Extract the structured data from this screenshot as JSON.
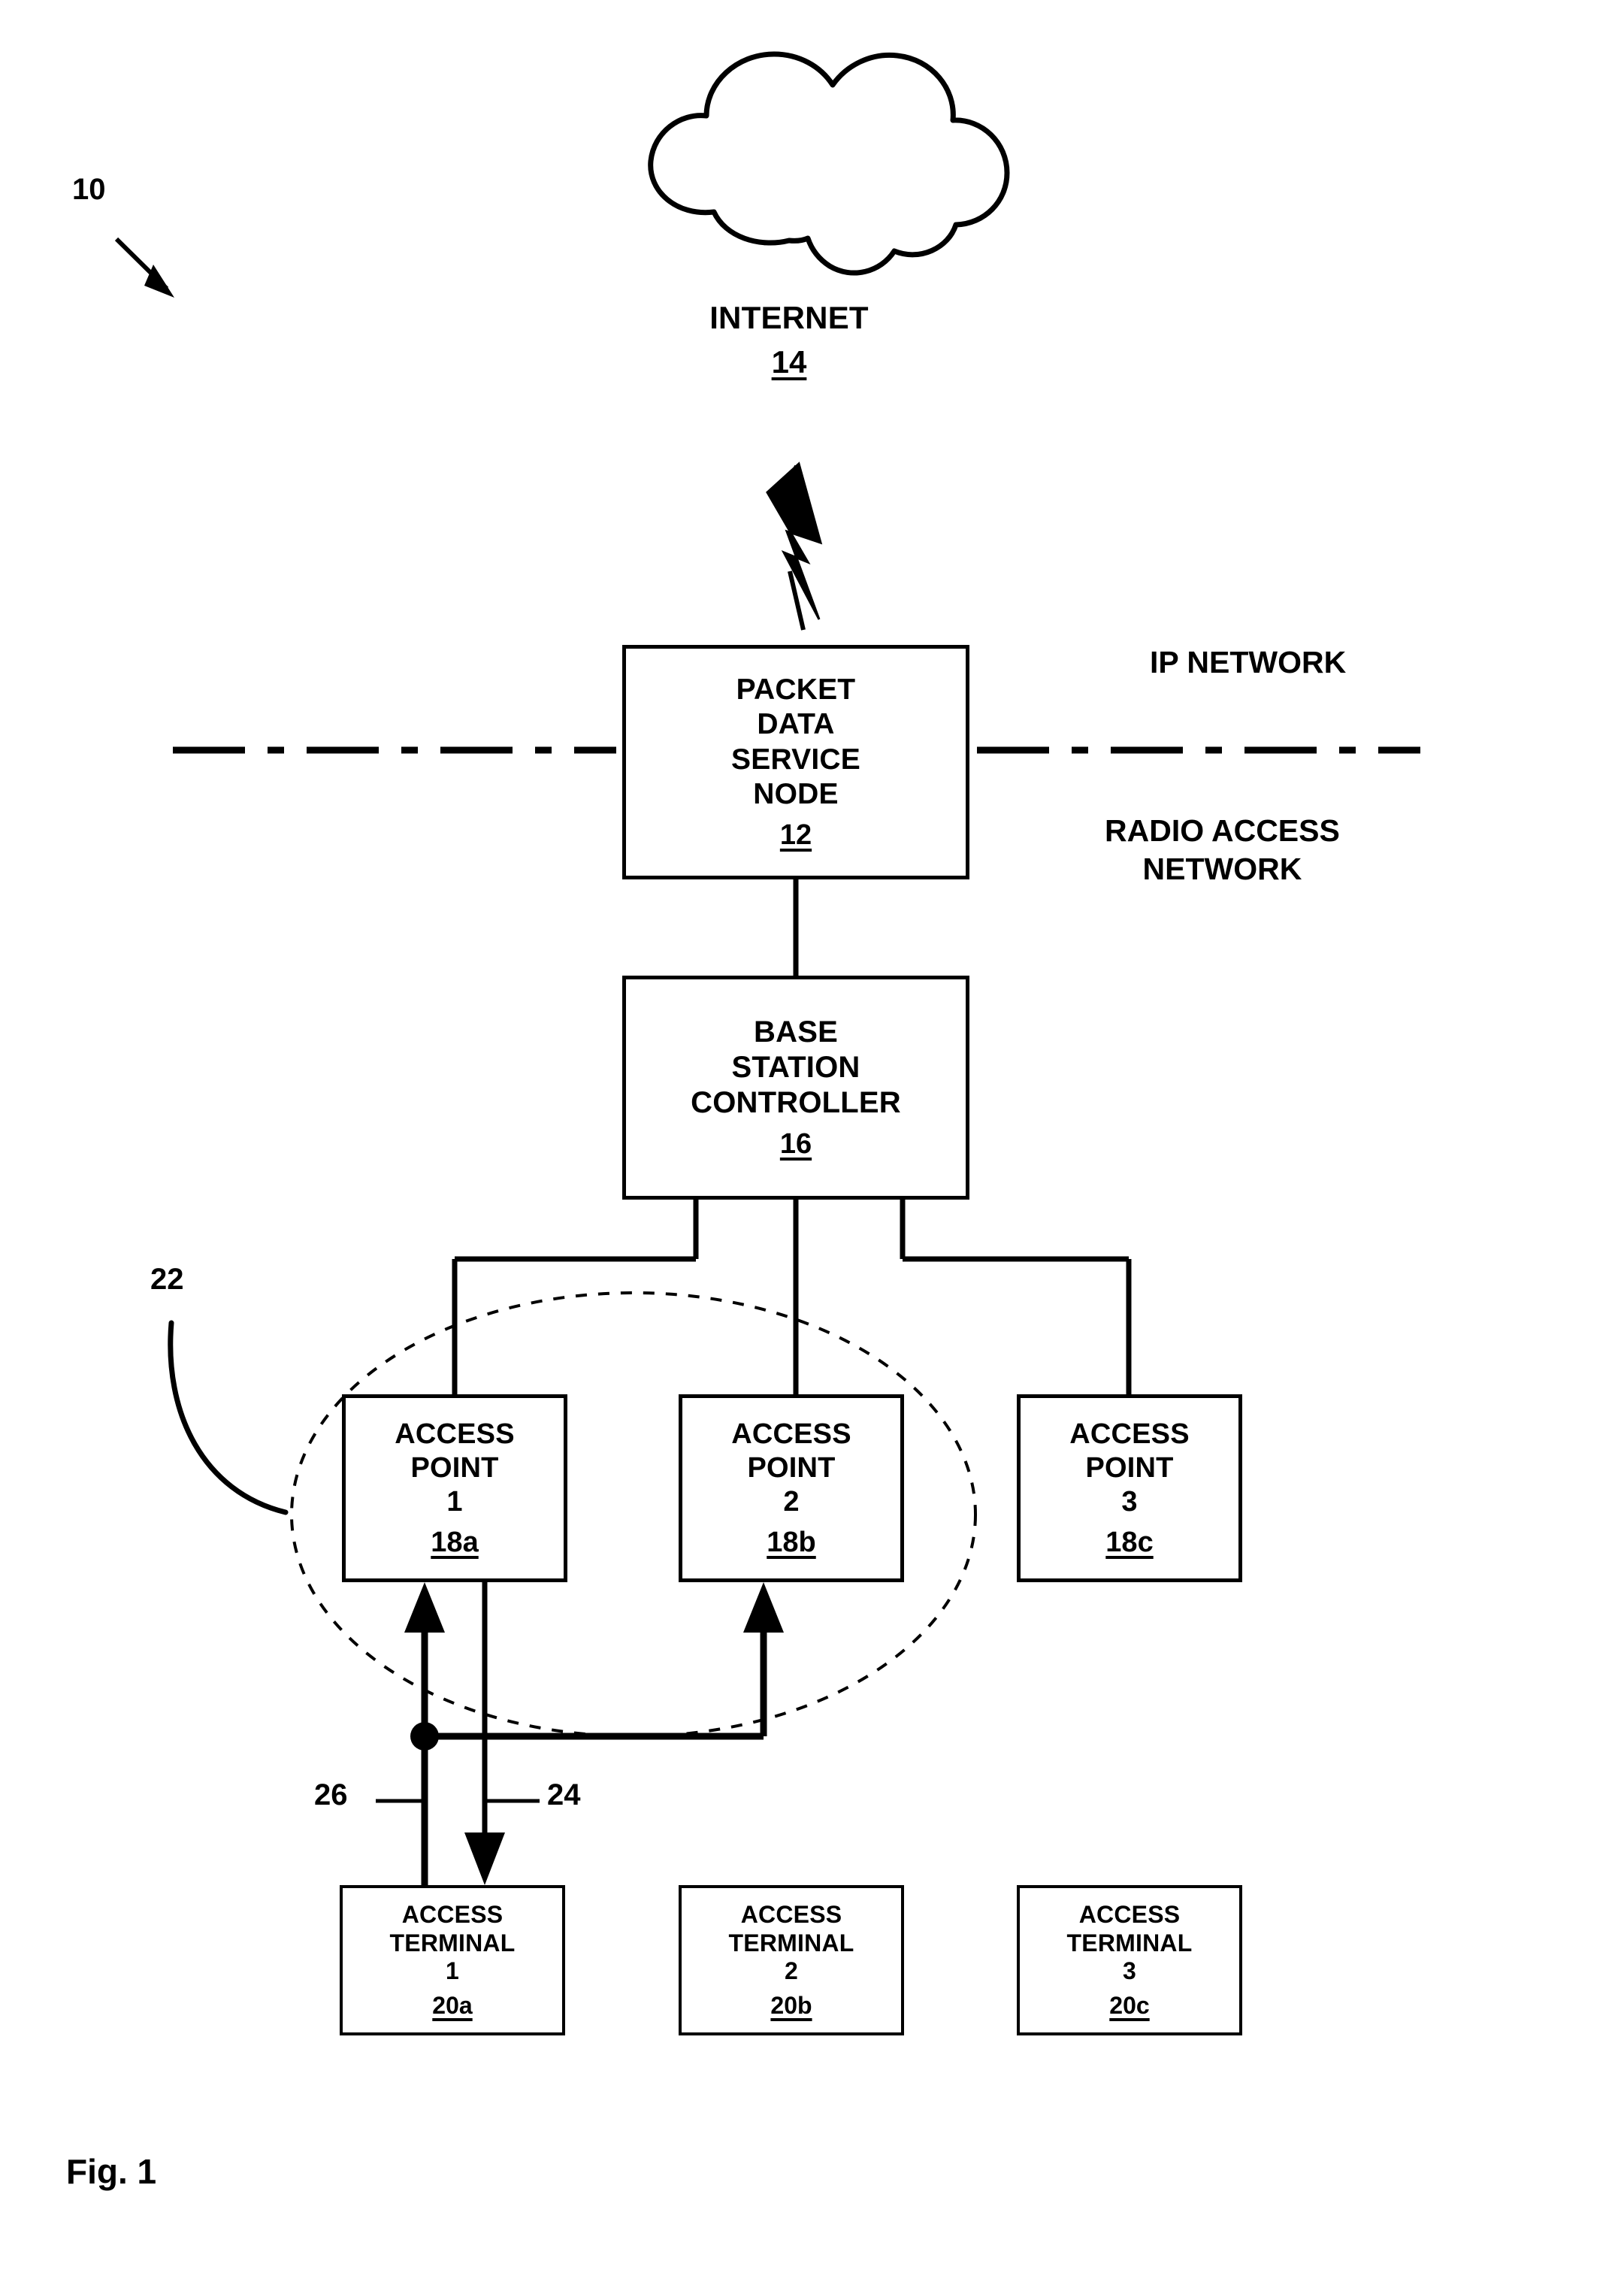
{
  "figure": {
    "caption": "Fig. 1",
    "system_ref": "10",
    "region_ref": "22",
    "link_ref_uplink": "26",
    "link_ref_downlink": "24"
  },
  "network_labels": {
    "ip_network": "IP NETWORK",
    "radio_access_network_line1": "RADIO ACCESS",
    "radio_access_network_line2": "NETWORK"
  },
  "cloud": {
    "name": "INTERNET",
    "ref": "14",
    "icon": "cloud-icon"
  },
  "nodes": {
    "pdsn": {
      "lines": [
        "PACKET",
        "DATA",
        "SERVICE",
        "NODE"
      ],
      "ref": "12"
    },
    "bsc": {
      "lines": [
        "BASE",
        "STATION",
        "CONTROLLER"
      ],
      "ref": "16"
    },
    "access_points": [
      {
        "line1": "ACCESS",
        "line2": "POINT",
        "index": "1",
        "ref": "18a"
      },
      {
        "line1": "ACCESS",
        "line2": "POINT",
        "index": "2",
        "ref": "18b"
      },
      {
        "line1": "ACCESS",
        "line2": "POINT",
        "index": "3",
        "ref": "18c"
      }
    ],
    "access_terminals": [
      {
        "line1": "ACCESS",
        "line2": "TERMINAL",
        "index": "1",
        "ref": "20a"
      },
      {
        "line1": "ACCESS",
        "line2": "TERMINAL",
        "index": "2",
        "ref": "20b"
      },
      {
        "line1": "ACCESS",
        "line2": "TERMINAL",
        "index": "3",
        "ref": "20c"
      }
    ]
  },
  "colors": {
    "stroke": "#000000",
    "background": "#ffffff"
  }
}
